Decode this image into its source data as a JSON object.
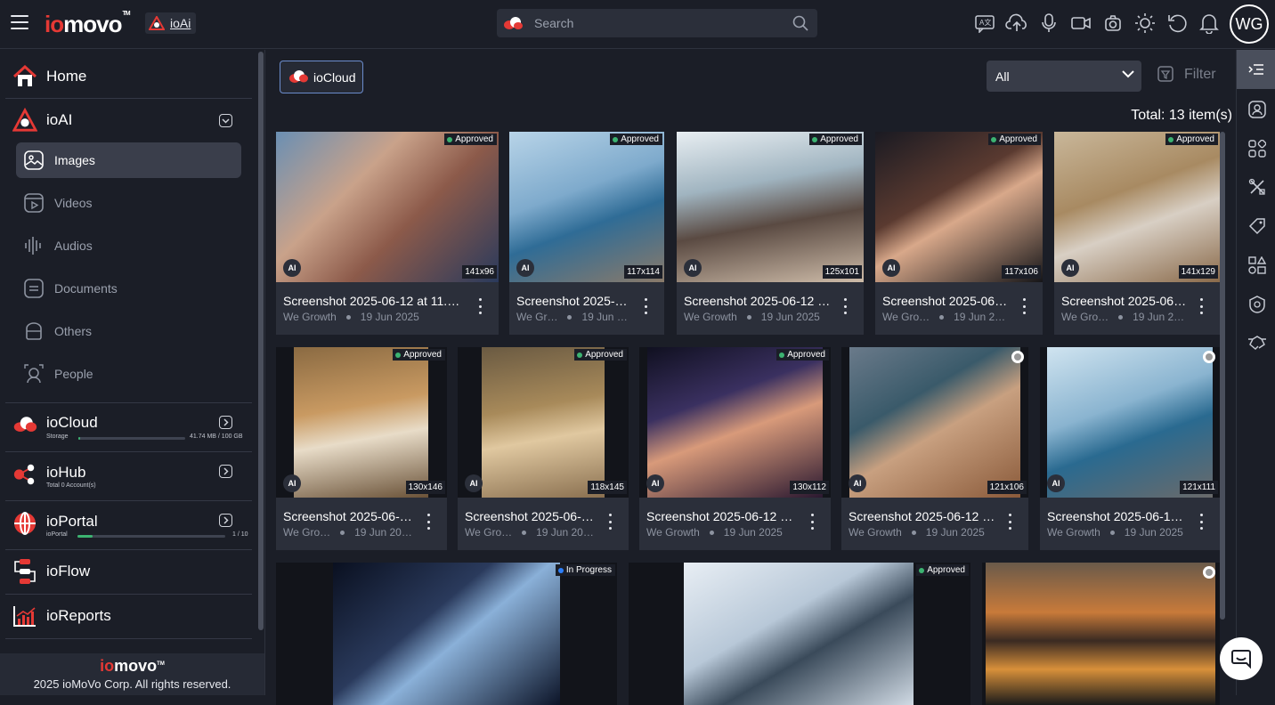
{
  "header": {
    "logo_prefix": "io",
    "logo_rest": "movo",
    "logo_tm": "TM",
    "module_chip": "ioAi",
    "search_placeholder": "Search",
    "avatar_initials": "WG",
    "icons": [
      "ai-translate-icon",
      "cloud-upload-icon",
      "microphone-icon",
      "video-camera-icon",
      "camera-icon",
      "brightness-icon",
      "refresh-icon",
      "bell-icon"
    ]
  },
  "sidebar": {
    "home": "Home",
    "ioai": "ioAI",
    "sub_items": [
      {
        "label": "Images",
        "icon": "image-icon",
        "active": true
      },
      {
        "label": "Videos",
        "icon": "video-icon",
        "active": false
      },
      {
        "label": "Audios",
        "icon": "audio-wave-icon",
        "active": false
      },
      {
        "label": "Documents",
        "icon": "document-icon",
        "active": false
      },
      {
        "label": "Others",
        "icon": "others-icon",
        "active": false
      },
      {
        "label": "People",
        "icon": "people-icon",
        "active": false
      }
    ],
    "iocloud": {
      "label": "ioCloud",
      "caption": "Storage",
      "usage": "41.74 MB / 100 GB",
      "progress": 0.0004
    },
    "iohub": {
      "label": "ioHub",
      "caption": "Total 0 Account(s)"
    },
    "ioportal": {
      "label": "ioPortal",
      "caption": "ioPortal",
      "usage": "1 / 10",
      "progress": 0.1
    },
    "ioflow": {
      "label": "ioFlow"
    },
    "ioreports": {
      "label": "ioReports"
    },
    "footer_logo_prefix": "io",
    "footer_logo_rest": "movo",
    "footer_tm": "TM",
    "copyright": "2025 ioMoVo Corp. All rights reserved."
  },
  "toolbar": {
    "source_button": "ioCloud",
    "filter_select": "All",
    "filter_button": "Filter",
    "total": "Total: 13 item(s)"
  },
  "cards": [
    {
      "title": "Screenshot 2025-06-12 at 11.…",
      "owner": "We Growth",
      "date": "19 Jun 2025",
      "status": "Approved",
      "dims": "141x96",
      "ai": "AI"
    },
    {
      "title": "Screenshot 2025-…",
      "owner": "We Gr…",
      "date": "19 Jun …",
      "status": "Approved",
      "dims": "117x114",
      "ai": "AI"
    },
    {
      "title": "Screenshot 2025-06-12 …",
      "owner": "We Growth",
      "date": "19 Jun 2025",
      "status": "Approved",
      "dims": "125x101",
      "ai": "AI"
    },
    {
      "title": "Screenshot 2025-06…",
      "owner": "We Gro…",
      "date": "19 Jun 2…",
      "status": "Approved",
      "dims": "117x106",
      "ai": "AI"
    },
    {
      "title": "Screenshot 2025-06…",
      "owner": "We Gro…",
      "date": "19 Jun 2…",
      "status": "Approved",
      "dims": "141x129",
      "ai": "AI"
    },
    {
      "title": "Screenshot 2025-06-…",
      "owner": "We Gro…",
      "date": "19 Jun 20…",
      "status": "Approved",
      "dims": "130x146",
      "ai": "AI"
    },
    {
      "title": "Screenshot 2025-06-…",
      "owner": "We Gro…",
      "date": "19 Jun 20…",
      "status": "Approved",
      "dims": "118x145",
      "ai": "AI"
    },
    {
      "title": "Screenshot 2025-06-12 …",
      "owner": "We Growth",
      "date": "19 Jun 2025",
      "status": "Approved",
      "dims": "130x112",
      "ai": "AI"
    },
    {
      "title": "Screenshot 2025-06-12 …",
      "owner": "We Growth",
      "date": "19 Jun 2025",
      "status": "",
      "dims": "121x106",
      "ai": "AI"
    },
    {
      "title": "Screenshot 2025-06-1…",
      "owner": "We Growth",
      "date": "19 Jun 2025",
      "status": "",
      "dims": "121x111",
      "ai": "AI"
    },
    {
      "status": "In Progress"
    },
    {
      "status": "Approved"
    },
    {
      "status": ""
    }
  ],
  "rightbar_icons": [
    "collapse-panel-icon",
    "user-profile-icon",
    "grid-apps-icon",
    "tools-icon",
    "tag-icon",
    "shapes-icon",
    "security-icon",
    "handshake-icon"
  ]
}
